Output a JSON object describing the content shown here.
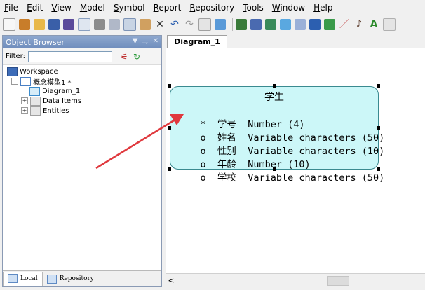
{
  "menu": {
    "items": [
      "File",
      "Edit",
      "View",
      "Model",
      "Symbol",
      "Report",
      "Repository",
      "Tools",
      "Window",
      "Help"
    ]
  },
  "toolbar": {
    "icons": [
      "new-icon",
      "open-model-icon",
      "open-folder-icon",
      "save-icon",
      "save-all-icon",
      "print-preview-icon",
      "print-icon",
      "cut-icon",
      "copy-icon",
      "paste-icon",
      "delete-icon",
      "undo-icon",
      "redo-icon",
      "properties-icon",
      "check-model-icon",
      "pointer-icon",
      "grid-icon",
      "table-icon",
      "view-icon",
      "reference-icon",
      "procedure-icon",
      "package-icon",
      "diagram-icon",
      "link-icon",
      "palette-icon",
      "text-icon",
      "extra-icon"
    ]
  },
  "object_browser": {
    "title": "Object Browser",
    "filter_label": "Filter:",
    "filter_value": "",
    "tree": {
      "workspace": "Workspace",
      "model": "概念模型1 *",
      "diagram": "Diagram_1",
      "data_items": "Data Items",
      "entities": "Entities"
    },
    "tabs": {
      "local": "Local",
      "repository": "Repository"
    }
  },
  "diagram": {
    "tab_label": "Diagram_1",
    "entity": {
      "name": "学生",
      "attributes": [
        {
          "marker": "*",
          "name": "学号",
          "type": "Number (4)"
        },
        {
          "marker": "o",
          "name": "姓名",
          "type": "Variable characters (50)"
        },
        {
          "marker": "o",
          "name": "性别",
          "type": "Variable characters (10)"
        },
        {
          "marker": "o",
          "name": "年龄",
          "type": "Number (10)"
        },
        {
          "marker": "o",
          "name": "学校",
          "type": "Variable characters (50)"
        }
      ]
    },
    "colors": {
      "entity_fill": "#ccf7f8",
      "entity_border": "#3a8a90",
      "annotation_arrow": "#e0393e"
    }
  },
  "scrollbar": {
    "left_arrow": "<"
  }
}
